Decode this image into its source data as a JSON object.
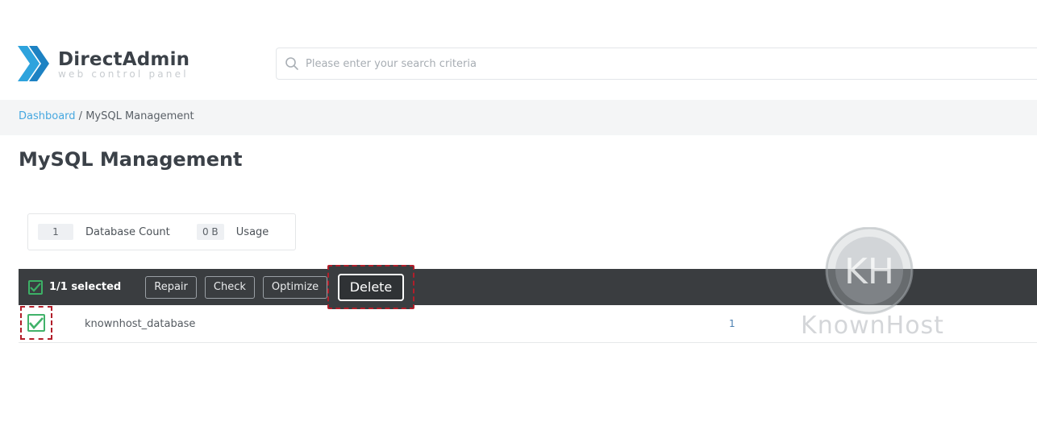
{
  "brand": {
    "title": "DirectAdmin",
    "subtitle": "web control panel",
    "accent": "#2ea3dd"
  },
  "search": {
    "placeholder": "Please enter your search criteria"
  },
  "breadcrumb": {
    "link": "Dashboard",
    "separator": " / ",
    "current": "MySQL Management"
  },
  "page": {
    "title": "MySQL Management"
  },
  "stats": {
    "database_count_value": "1",
    "database_count_label": "Database Count",
    "usage_value": "0 B",
    "usage_label": "Usage"
  },
  "actionbar": {
    "selected_text": "1/1 selected",
    "buttons": {
      "repair": "Repair",
      "check": "Check",
      "optimize": "Optimize",
      "delete": "Delete"
    }
  },
  "table": {
    "rows": [
      {
        "name": "knownhost_database",
        "count": "1",
        "checked": true
      }
    ]
  },
  "watermark": {
    "text": "KnownHost",
    "monogram": "KH"
  },
  "colors": {
    "action_bar": "#3a3d40",
    "checkbox_green": "#41b26a",
    "highlight_red": "#b21e2a",
    "link_blue": "#47a8e0"
  }
}
